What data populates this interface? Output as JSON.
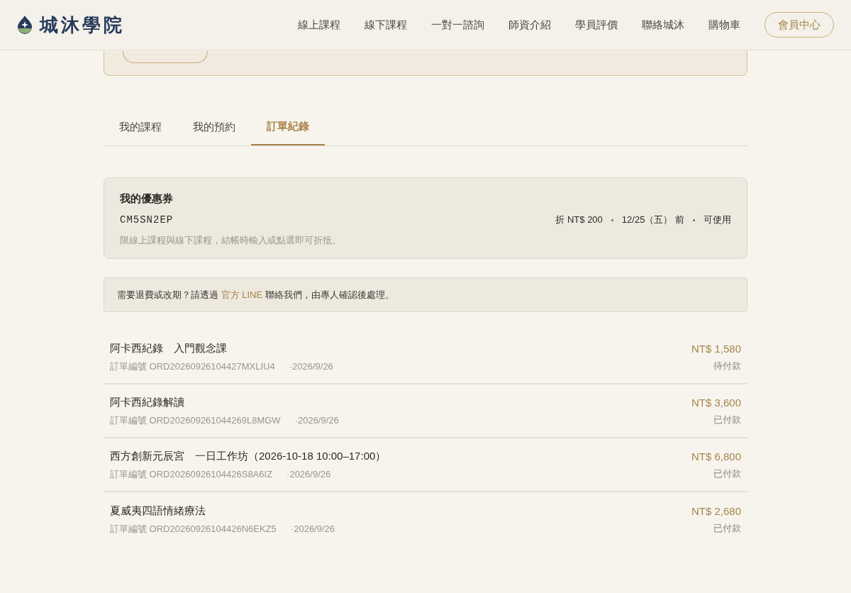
{
  "header": {
    "brand": "城沐學院",
    "nav": [
      {
        "label": "線上課程"
      },
      {
        "label": "線下課程"
      },
      {
        "label": "一對一諮詢"
      },
      {
        "label": "師資介紹"
      },
      {
        "label": "學員評價"
      },
      {
        "label": "聯絡城沐"
      },
      {
        "label": "購物車"
      }
    ],
    "member_button": "會員中心"
  },
  "tabs": [
    {
      "label": "我的課程",
      "selected": false
    },
    {
      "label": "我的預約",
      "selected": false
    },
    {
      "label": "訂單紀錄",
      "selected": true
    }
  ],
  "coupon": {
    "title": "我的優惠券",
    "code": "CM5SN2EP",
    "note": "限線上課程與線下課程，結帳時輸入或點選即可折抵。",
    "discount": "折 NT$ 200",
    "expiry": "12/25（五） 前",
    "status": "可使用"
  },
  "notice": {
    "before": "需要退費或改期？請透過",
    "link": "官方 LINE",
    "after": "聯絡我們，由專人確認後處理。"
  },
  "orders": [
    {
      "title": "阿卡西紀錄　入門觀念課",
      "number": "訂單編號 ORD20260926104427MXLIU4",
      "date": "·2026/9/26",
      "price": "NT$ 1,580",
      "status": "待付款"
    },
    {
      "title": "阿卡西紀錄解讀",
      "number": "訂單編號 ORD202609261044269L8MGW",
      "date": "·2026/9/26",
      "price": "NT$ 3,600",
      "status": "已付款"
    },
    {
      "title": "西方創新元辰宮　一日工作坊（2026-10-18 10:00–17:00）",
      "number": "訂單編號 ORD20260926104426S8A6IZ",
      "date": "·2026/9/26",
      "price": "NT$ 6,800",
      "status": "已付款"
    },
    {
      "title": "夏威夷四語情緒療法",
      "number": "訂單編號 ORD20260926104426N6EKZ5",
      "date": "·2026/9/26",
      "price": "NT$ 2,680",
      "status": "已付款"
    }
  ]
}
